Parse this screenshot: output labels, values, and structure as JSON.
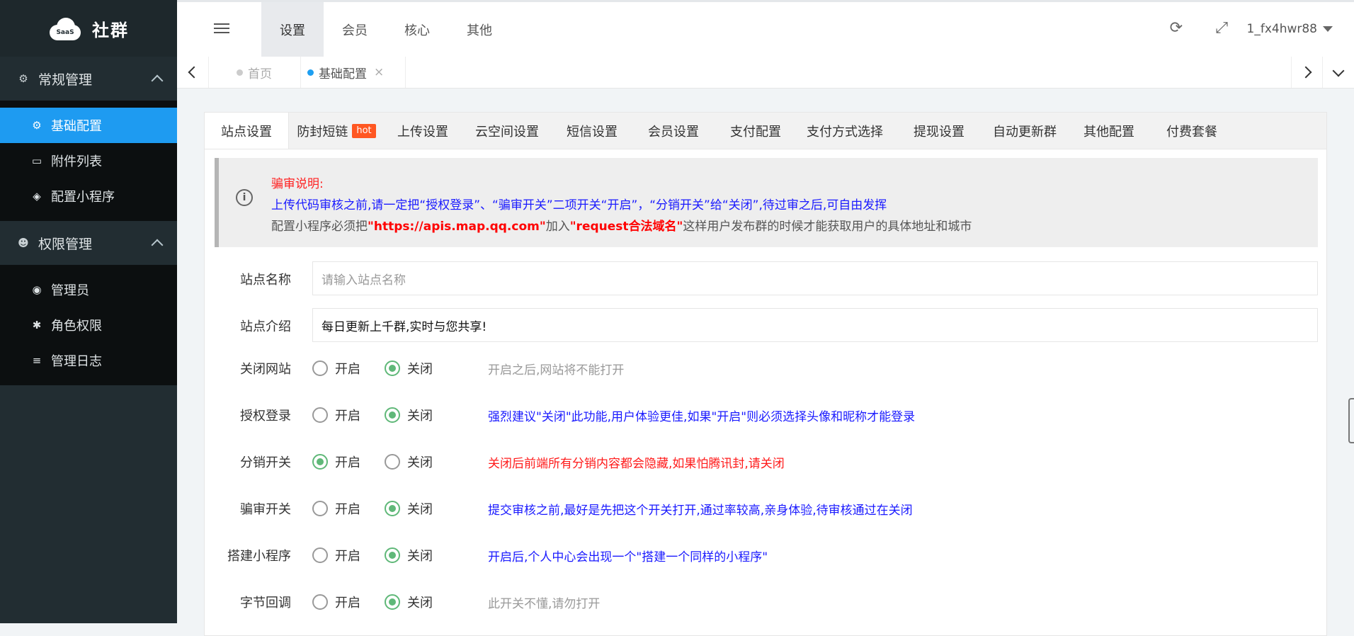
{
  "brand": {
    "logo_badge": "SaaS",
    "name": "社群"
  },
  "sidebar": {
    "groups": [
      {
        "title": "常规管理",
        "icon": "gear-icon",
        "items": [
          {
            "label": "基础配置",
            "icon": "gear-icon",
            "active": true
          },
          {
            "label": "附件列表",
            "icon": "folder-icon"
          },
          {
            "label": "配置小程序",
            "icon": "codepen-icon"
          }
        ]
      },
      {
        "title": "权限管理",
        "icon": "github-icon",
        "items": [
          {
            "label": "管理员",
            "icon": "download-circle-icon"
          },
          {
            "label": "角色权限",
            "icon": "bug-icon"
          },
          {
            "label": "管理日志",
            "icon": "list-icon"
          }
        ]
      }
    ]
  },
  "topnav": {
    "items": [
      "设置",
      "会员",
      "核心",
      "其他"
    ],
    "active": "设置"
  },
  "user": {
    "name": "1_fx4hwr88"
  },
  "tabs": [
    {
      "label": "首页",
      "dot_color": "#cccccc"
    },
    {
      "label": "基础配置",
      "dot_color": "#1e9ff1",
      "close": "×"
    }
  ],
  "subtabs": [
    "站点设置",
    "防封短链",
    "上传设置",
    "云空间设置",
    "短信设置",
    "会员设置",
    "支付配置",
    "支付方式选择",
    "提现设置",
    "自动更新群",
    "其他配置",
    "付费套餐"
  ],
  "hot_badge": "hot",
  "notice": {
    "line1": "骗审说明:",
    "line2": "上传代码审核之前,请一定把“授权登录”、“骗审开关”二项开关“开启”，“分销开关”给“关闭”,待过审之后,可自由发挥",
    "line3_a": "配置小程序必须把",
    "line3_b": "\"https://apis.map.qq.com\"",
    "line3_c": "加入",
    "line3_d": "\"request合法域名\"",
    "line3_e": "这样用户发布群的时候才能获取用户的具体地址和城市"
  },
  "form": {
    "site_name": {
      "label": "站点名称",
      "placeholder": "请输入站点名称",
      "value": ""
    },
    "site_intro": {
      "label": "站点介绍",
      "value": "每日更新上千群,实时与您共享!"
    },
    "on_label": "开启",
    "off_label": "关闭",
    "switches": [
      {
        "label": "关闭网站",
        "value": "off",
        "hint": "开启之后,网站将不能打开",
        "hint_color": "gray"
      },
      {
        "label": "授权登录",
        "value": "off",
        "hint": "强烈建议\"关闭\"此功能,用户体验更佳,如果\"开启\"则必须选择头像和昵称才能登录",
        "hint_color": "blue"
      },
      {
        "label": "分销开关",
        "value": "on",
        "hint": "关闭后前端所有分销内容都会隐藏,如果怕腾讯封,请关闭",
        "hint_color": "red"
      },
      {
        "label": "骗审开关",
        "value": "off",
        "hint": "提交审核之前,最好是先把这个开关打开,通过率较高,亲身体验,待审核通过在关闭",
        "hint_color": "blue"
      },
      {
        "label": "搭建小程序",
        "value": "off",
        "hint": "开启后,个人中心会出现一个\"搭建一个同样的小程序\"",
        "hint_color": "blue"
      },
      {
        "label": "字节回调",
        "value": "off",
        "hint": "此开关不懂,请勿打开",
        "hint_color": "gray"
      }
    ]
  }
}
